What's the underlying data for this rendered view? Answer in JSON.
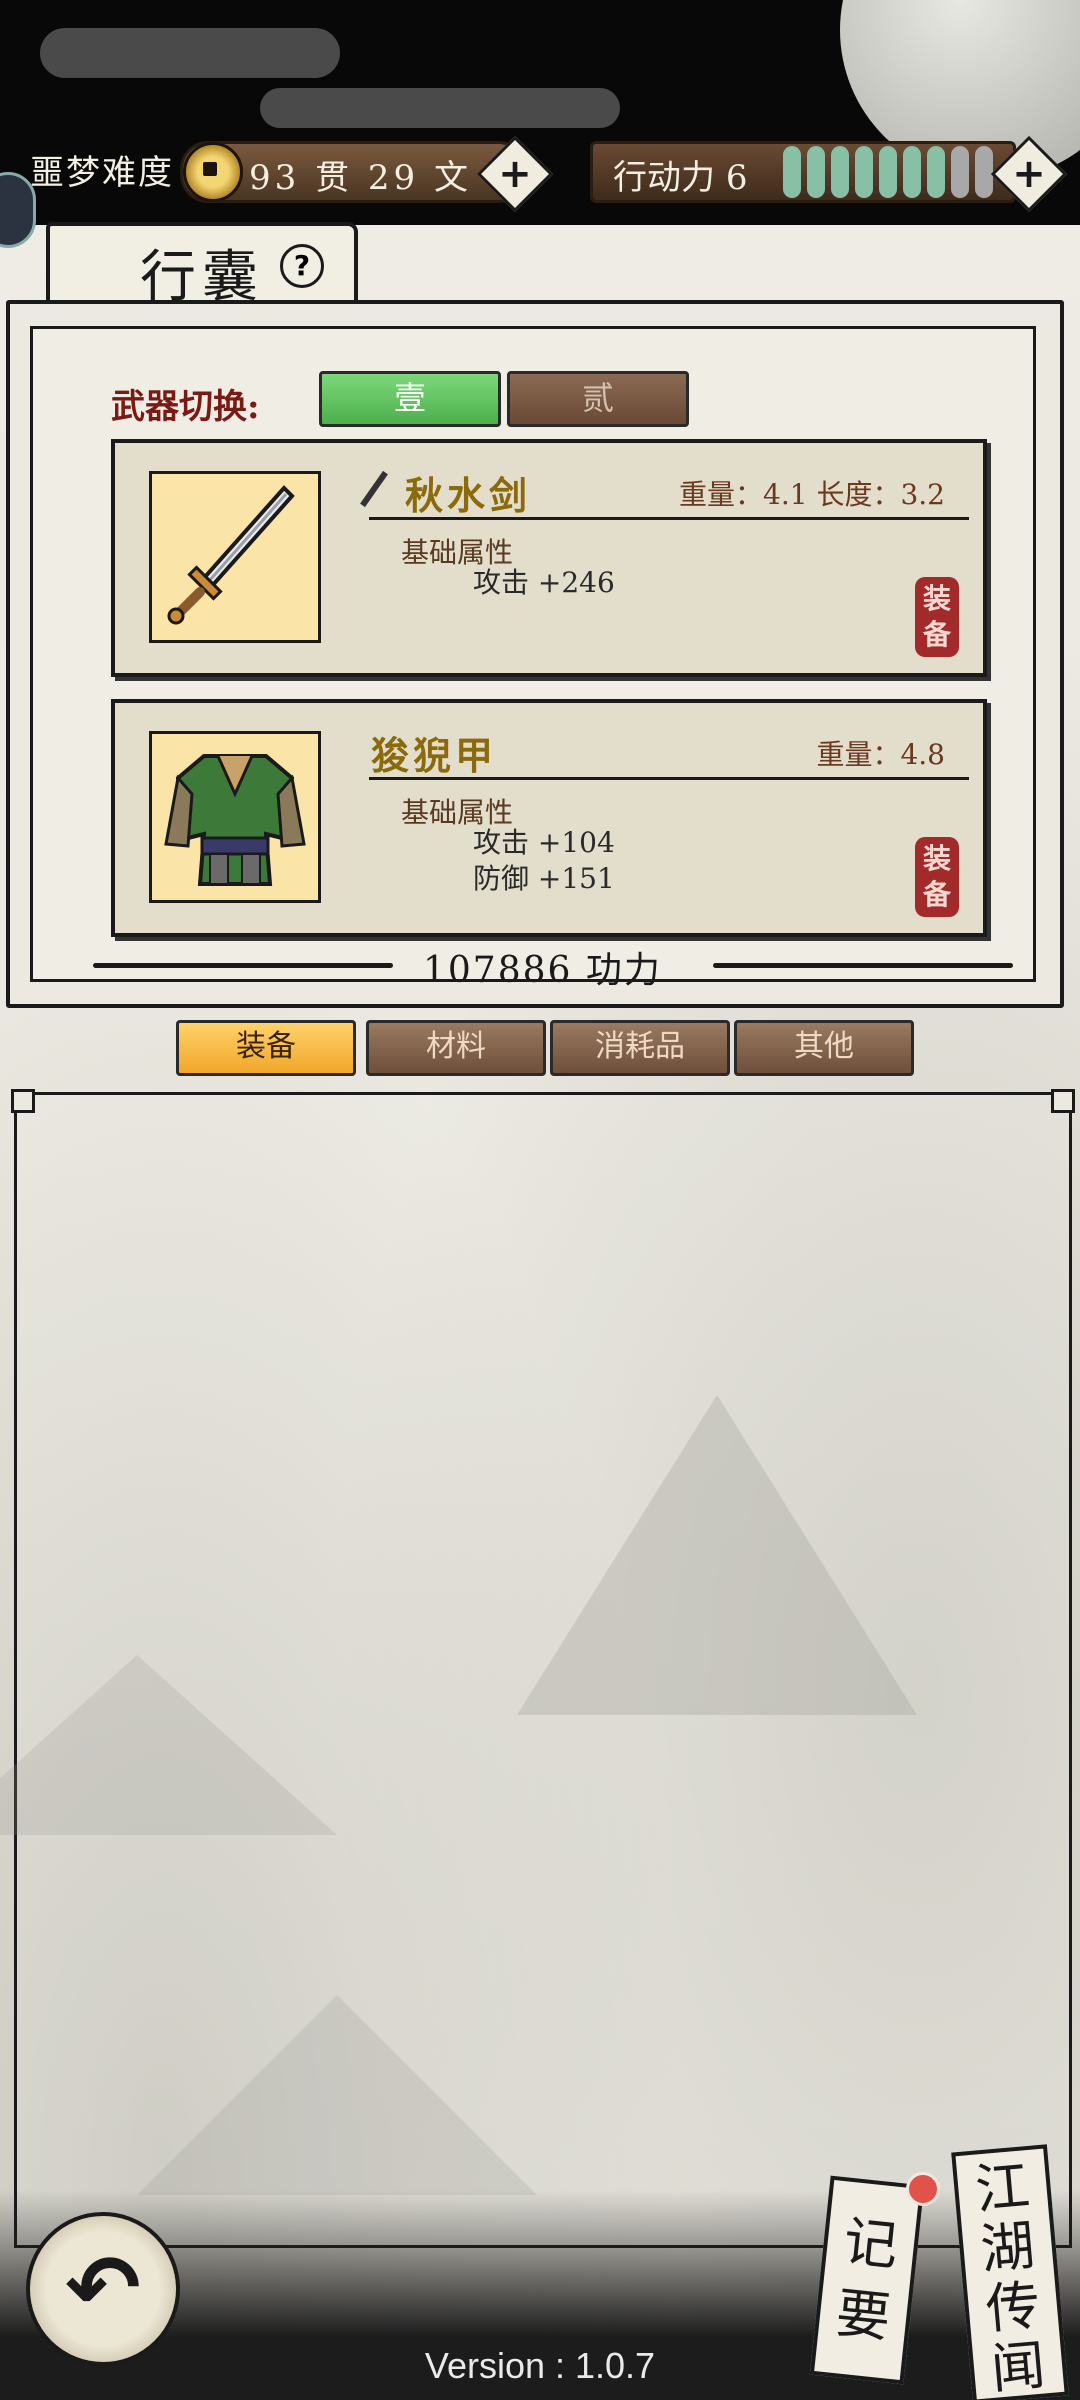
{
  "status_bar": {
    "difficulty": "噩梦难度",
    "money": {
      "guan": "93",
      "guan_unit": "贯",
      "wen": "29",
      "wen_unit": "文"
    },
    "action_label": "行动力",
    "action_value": "6",
    "action_level": {
      "filled": 7,
      "total": 9
    }
  },
  "panel": {
    "title": "行囊",
    "help_icon": "?",
    "weapon_switch_label": "武器切换:",
    "weapon_sets": [
      "壹",
      "贰"
    ],
    "active_weapon_set": "壹",
    "items": [
      {
        "name": "秋水剑",
        "stats": "重量：4.1  长度：3.2",
        "category": "基础属性",
        "attributes": [
          "攻击 +246"
        ],
        "equip_seal": [
          "装",
          "备"
        ],
        "icon": "sword-icon"
      },
      {
        "name": "狻猊甲",
        "stats": "重量：4.8",
        "category": "基础属性",
        "attributes": [
          "攻击 +104",
          "防御 +151"
        ],
        "equip_seal": [
          "装",
          "备"
        ],
        "icon": "armor-icon"
      }
    ],
    "power": "107886 功力"
  },
  "categories": [
    {
      "label": "装备",
      "active": true
    },
    {
      "label": "材料",
      "active": false
    },
    {
      "label": "消耗品",
      "active": false
    },
    {
      "label": "其他",
      "active": false
    }
  ],
  "bottom": {
    "back_icon": "back-arrow-icon",
    "notes_label": [
      "记",
      "要"
    ],
    "news_label": [
      "江",
      "湖",
      "传",
      "闻"
    ],
    "version": "Version : 1.0.7"
  },
  "colors": {
    "accent_green": "#5cbd5a",
    "accent_orange": "#f5b23c",
    "item_name": "#8a6a0a",
    "seal_red": "#a22a2a",
    "action_bar": "#87c0a5"
  }
}
